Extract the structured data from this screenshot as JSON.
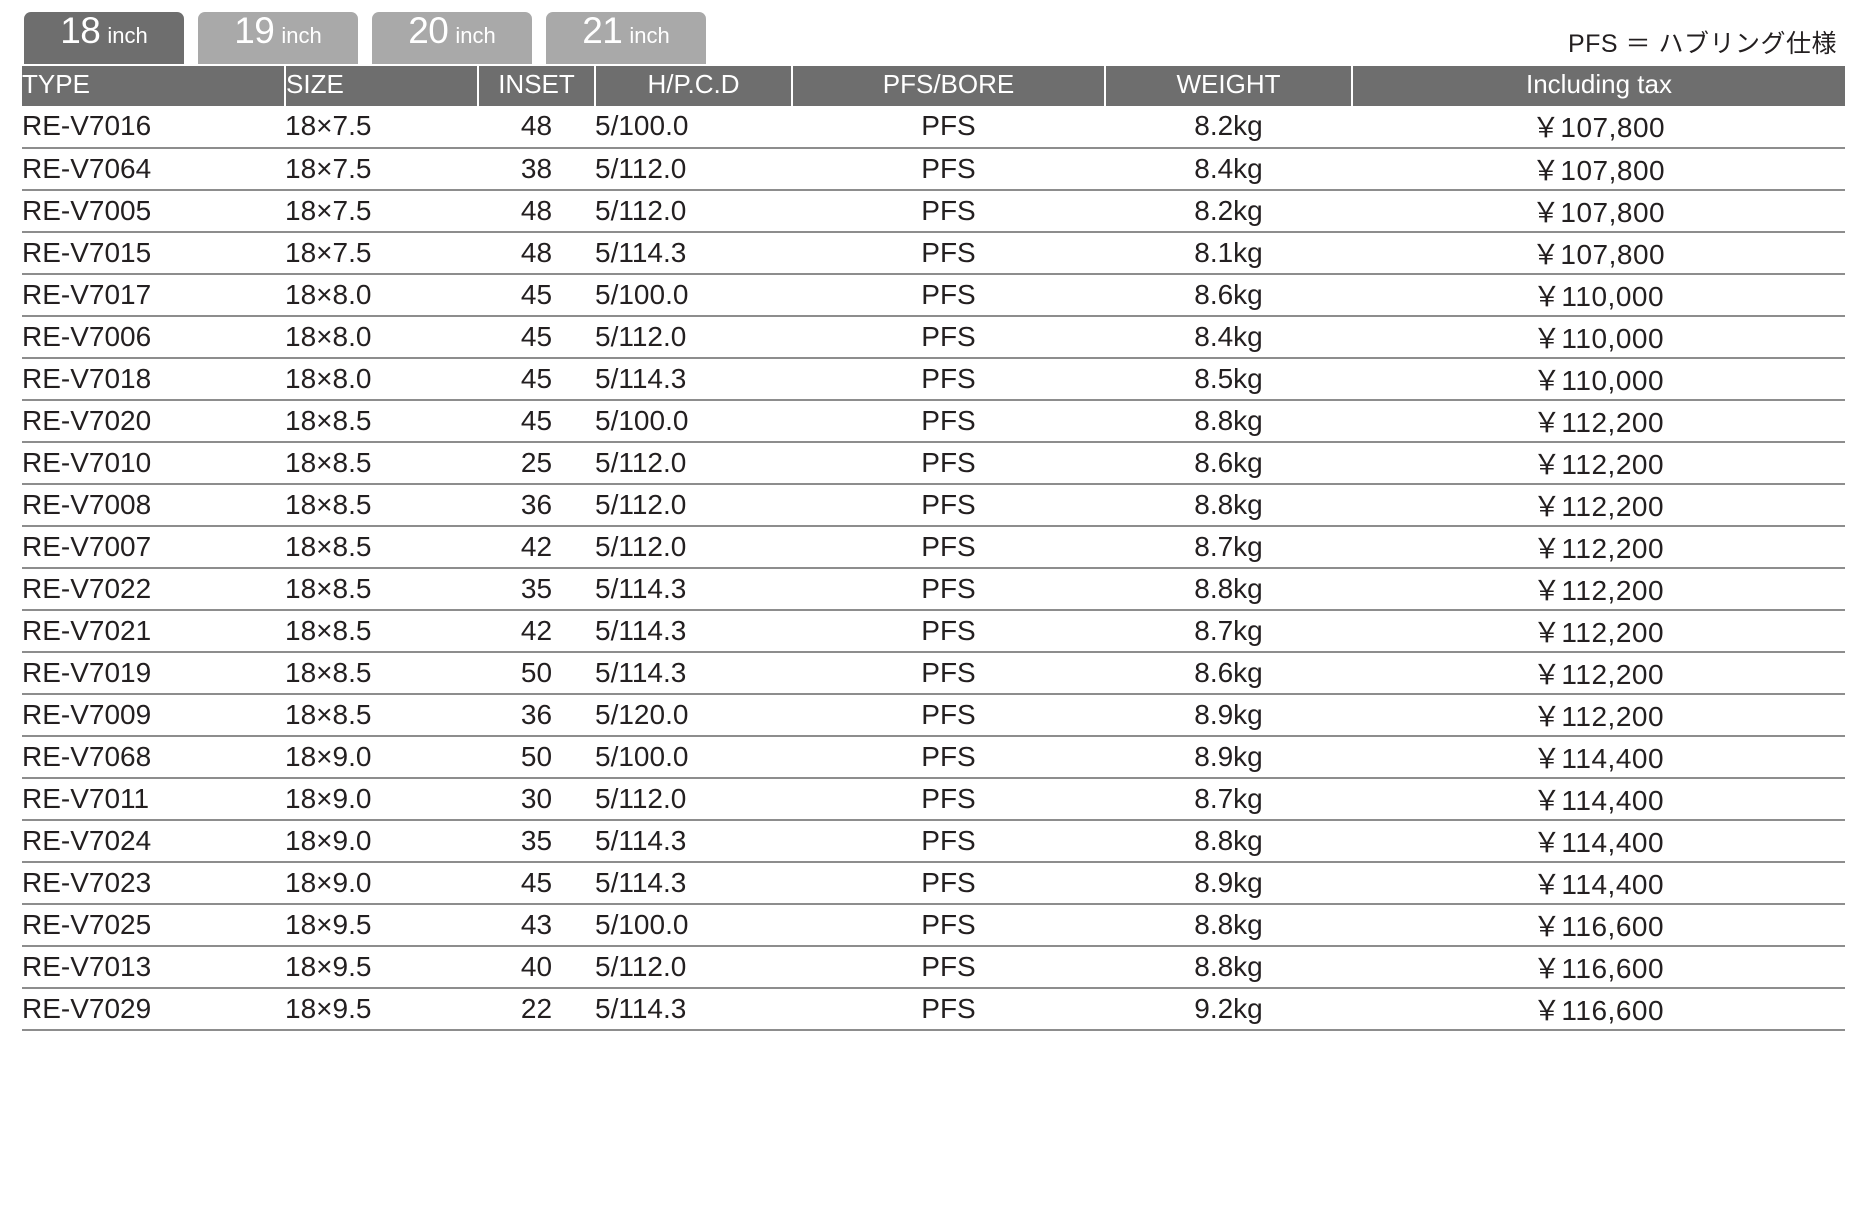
{
  "tabs": [
    {
      "num": "18",
      "unit": "inch",
      "active": true
    },
    {
      "num": "19",
      "unit": "inch",
      "active": false
    },
    {
      "num": "20",
      "unit": "inch",
      "active": false
    },
    {
      "num": "21",
      "unit": "inch",
      "active": false
    }
  ],
  "note": "PFS ＝ ハブリング仕様",
  "table": {
    "columns": [
      "TYPE",
      "SIZE",
      "INSET",
      "H/P.C.D",
      "PFS/BORE",
      "WEIGHT",
      "Including tax"
    ],
    "rows": [
      {
        "type": "RE-V7016",
        "size": "18×7.5",
        "inset": "48",
        "hpcd": "5/100.0",
        "pfs": "PFS",
        "weight": "8.2kg",
        "price": "￥107,800"
      },
      {
        "type": "RE-V7064",
        "size": "18×7.5",
        "inset": "38",
        "hpcd": "5/112.0",
        "pfs": "PFS",
        "weight": "8.4kg",
        "price": "￥107,800"
      },
      {
        "type": "RE-V7005",
        "size": "18×7.5",
        "inset": "48",
        "hpcd": "5/112.0",
        "pfs": "PFS",
        "weight": "8.2kg",
        "price": "￥107,800"
      },
      {
        "type": "RE-V7015",
        "size": "18×7.5",
        "inset": "48",
        "hpcd": "5/114.3",
        "pfs": "PFS",
        "weight": "8.1kg",
        "price": "￥107,800"
      },
      {
        "type": "RE-V7017",
        "size": "18×8.0",
        "inset": "45",
        "hpcd": "5/100.0",
        "pfs": "PFS",
        "weight": "8.6kg",
        "price": "￥110,000"
      },
      {
        "type": "RE-V7006",
        "size": "18×8.0",
        "inset": "45",
        "hpcd": "5/112.0",
        "pfs": "PFS",
        "weight": "8.4kg",
        "price": "￥110,000"
      },
      {
        "type": "RE-V7018",
        "size": "18×8.0",
        "inset": "45",
        "hpcd": "5/114.3",
        "pfs": "PFS",
        "weight": "8.5kg",
        "price": "￥110,000"
      },
      {
        "type": "RE-V7020",
        "size": "18×8.5",
        "inset": "45",
        "hpcd": "5/100.0",
        "pfs": "PFS",
        "weight": "8.8kg",
        "price": "￥112,200"
      },
      {
        "type": "RE-V7010",
        "size": "18×8.5",
        "inset": "25",
        "hpcd": "5/112.0",
        "pfs": "PFS",
        "weight": "8.6kg",
        "price": "￥112,200"
      },
      {
        "type": "RE-V7008",
        "size": "18×8.5",
        "inset": "36",
        "hpcd": "5/112.0",
        "pfs": "PFS",
        "weight": "8.8kg",
        "price": "￥112,200"
      },
      {
        "type": "RE-V7007",
        "size": "18×8.5",
        "inset": "42",
        "hpcd": "5/112.0",
        "pfs": "PFS",
        "weight": "8.7kg",
        "price": "￥112,200"
      },
      {
        "type": "RE-V7022",
        "size": "18×8.5",
        "inset": "35",
        "hpcd": "5/114.3",
        "pfs": "PFS",
        "weight": "8.8kg",
        "price": "￥112,200"
      },
      {
        "type": "RE-V7021",
        "size": "18×8.5",
        "inset": "42",
        "hpcd": "5/114.3",
        "pfs": "PFS",
        "weight": "8.7kg",
        "price": "￥112,200"
      },
      {
        "type": "RE-V7019",
        "size": "18×8.5",
        "inset": "50",
        "hpcd": "5/114.3",
        "pfs": "PFS",
        "weight": "8.6kg",
        "price": "￥112,200"
      },
      {
        "type": "RE-V7009",
        "size": "18×8.5",
        "inset": "36",
        "hpcd": "5/120.0",
        "pfs": "PFS",
        "weight": "8.9kg",
        "price": "￥112,200"
      },
      {
        "type": "RE-V7068",
        "size": "18×9.0",
        "inset": "50",
        "hpcd": "5/100.0",
        "pfs": "PFS",
        "weight": "8.9kg",
        "price": "￥114,400"
      },
      {
        "type": "RE-V7011",
        "size": "18×9.0",
        "inset": "30",
        "hpcd": "5/112.0",
        "pfs": "PFS",
        "weight": "8.7kg",
        "price": "￥114,400"
      },
      {
        "type": "RE-V7024",
        "size": "18×9.0",
        "inset": "35",
        "hpcd": "5/114.3",
        "pfs": "PFS",
        "weight": "8.8kg",
        "price": "￥114,400"
      },
      {
        "type": "RE-V7023",
        "size": "18×9.0",
        "inset": "45",
        "hpcd": "5/114.3",
        "pfs": "PFS",
        "weight": "8.9kg",
        "price": "￥114,400"
      },
      {
        "type": "RE-V7025",
        "size": "18×9.5",
        "inset": "43",
        "hpcd": "5/100.0",
        "pfs": "PFS",
        "weight": "8.8kg",
        "price": "￥116,600"
      },
      {
        "type": "RE-V7013",
        "size": "18×9.5",
        "inset": "40",
        "hpcd": "5/112.0",
        "pfs": "PFS",
        "weight": "8.8kg",
        "price": "￥116,600"
      },
      {
        "type": "RE-V7029",
        "size": "18×9.5",
        "inset": "22",
        "hpcd": "5/114.3",
        "pfs": "PFS",
        "weight": "9.2kg",
        "price": "￥116,600"
      }
    ]
  },
  "colors": {
    "header_bg": "#6e6e6e",
    "tab_active_bg": "#6e6e6e",
    "tab_inactive_bg": "#a9a9a9",
    "row_divider": "#8d8d8d",
    "text": "#231f20"
  }
}
